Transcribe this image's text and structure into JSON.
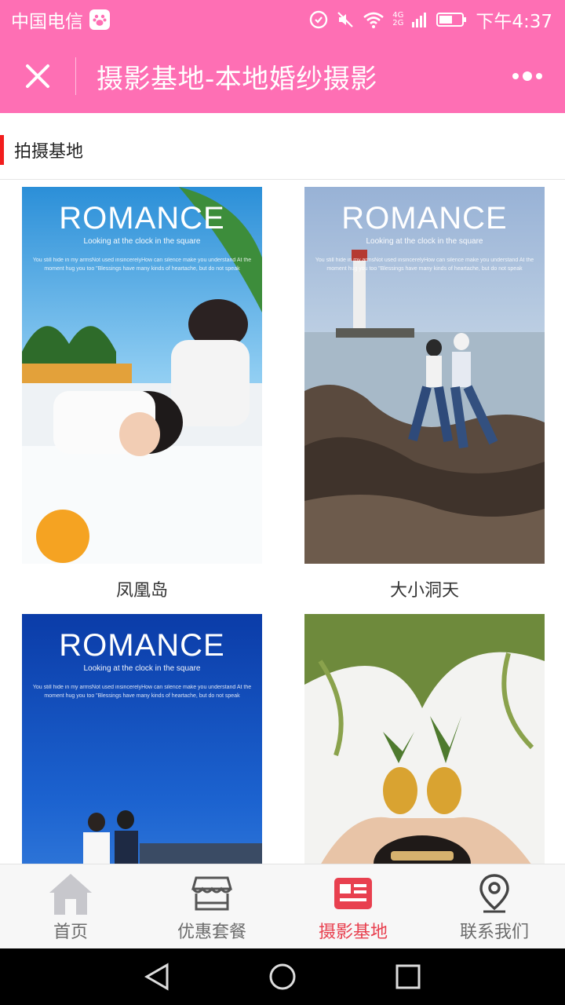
{
  "status": {
    "carrier": "中国电信",
    "network_top": "4G",
    "network_bottom": "2G",
    "time": "下午4:37"
  },
  "header": {
    "title": "摄影基地-本地婚纱摄影"
  },
  "section": {
    "title": "拍摄基地",
    "accent_color": "#f21d1d"
  },
  "cards": [
    {
      "caption": "凤凰岛",
      "brand": "ROMANCE",
      "tagline": "Looking at the clock in the square",
      "small_text": "You still hide in my armsNot used insincerelyHow can silence make you understand  At the moment hug you too \"Blessings have  many kinds of heartache, but do not speak"
    },
    {
      "caption": "大小洞天",
      "brand": "ROMANCE",
      "tagline": "Looking at the clock in the square",
      "small_text": "You still hide in my armsNot used insincerelyHow can silence make you understand  At the moment hug you too \"Blessings have  many kinds of heartache, but do not speak"
    },
    {
      "caption": "",
      "brand": "ROMANCE",
      "tagline": "Looking at the clock in the square",
      "small_text": "You still hide in my armsNot used insincerelyHow can silence make you understand  At the moment hug you too \"Blessings have  many kinds of heartache, but do not speak"
    },
    {
      "caption": "",
      "brand": "",
      "tagline": "",
      "small_text": ""
    }
  ],
  "tabs": [
    {
      "label": "首页",
      "icon": "home-icon"
    },
    {
      "label": "优惠套餐",
      "icon": "store-icon"
    },
    {
      "label": "摄影基地",
      "icon": "news-card-icon",
      "active": true
    },
    {
      "label": "联系我们",
      "icon": "location-pin-icon"
    }
  ],
  "colors": {
    "brand_pink": "#fe6fb4",
    "active_tab": "#e8404f",
    "inactive_tab": "#6b6b6b"
  }
}
